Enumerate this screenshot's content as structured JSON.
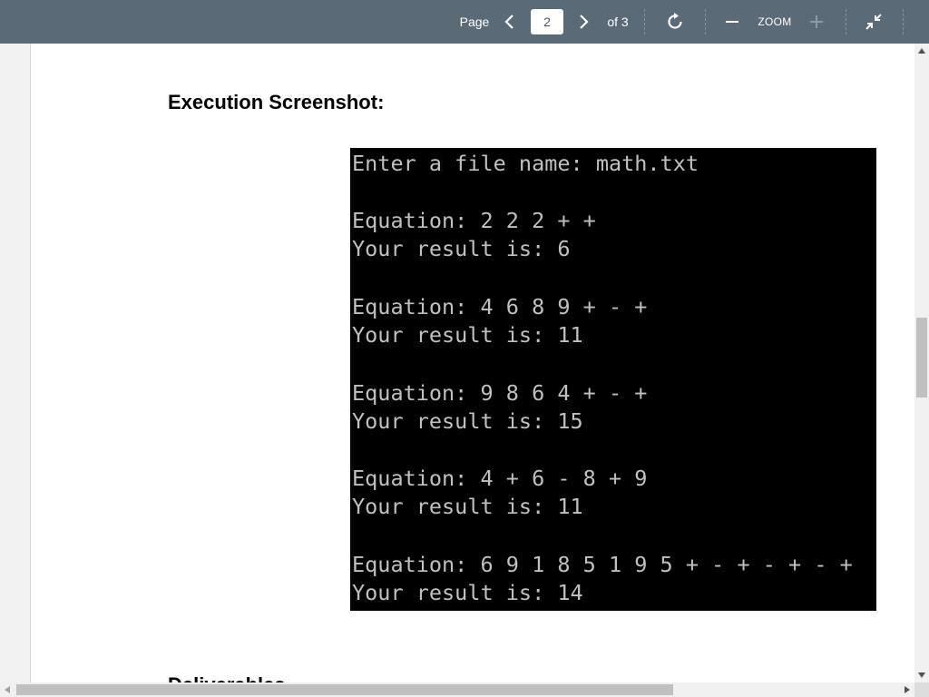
{
  "toolbar": {
    "page_label": "Page",
    "page_input_value": "2",
    "of_label": "of 3",
    "zoom_label": "ZOOM",
    "icons": [
      "chevron-left-icon",
      "chevron-right-icon",
      "rotate-icon",
      "minus-icon",
      "plus-icon",
      "collapse-icon"
    ],
    "colors": {
      "toolbar_bg": "#5a6a77",
      "toolbar_text": "#ffffff"
    }
  },
  "document": {
    "heading": "Execution Screenshot:",
    "next_heading": "Deliverables",
    "console_lines": [
      "Enter a file name: math.txt",
      "",
      "Equation: 2 2 2 + +",
      "Your result is: 6",
      "",
      "Equation: 4 6 8 9 + - +",
      "Your result is: 11",
      "",
      "Equation: 9 8 6 4 + - +",
      "Your result is: 15",
      "",
      "Equation: 4 + 6 - 8 + 9",
      "Your result is: 11",
      "",
      "Equation: 6 9 1 8 5 1 9 5 + - + - + - +",
      "Your result is: 14"
    ],
    "colors": {
      "console_bg": "#000000",
      "console_text": "#c0c0c0"
    }
  }
}
